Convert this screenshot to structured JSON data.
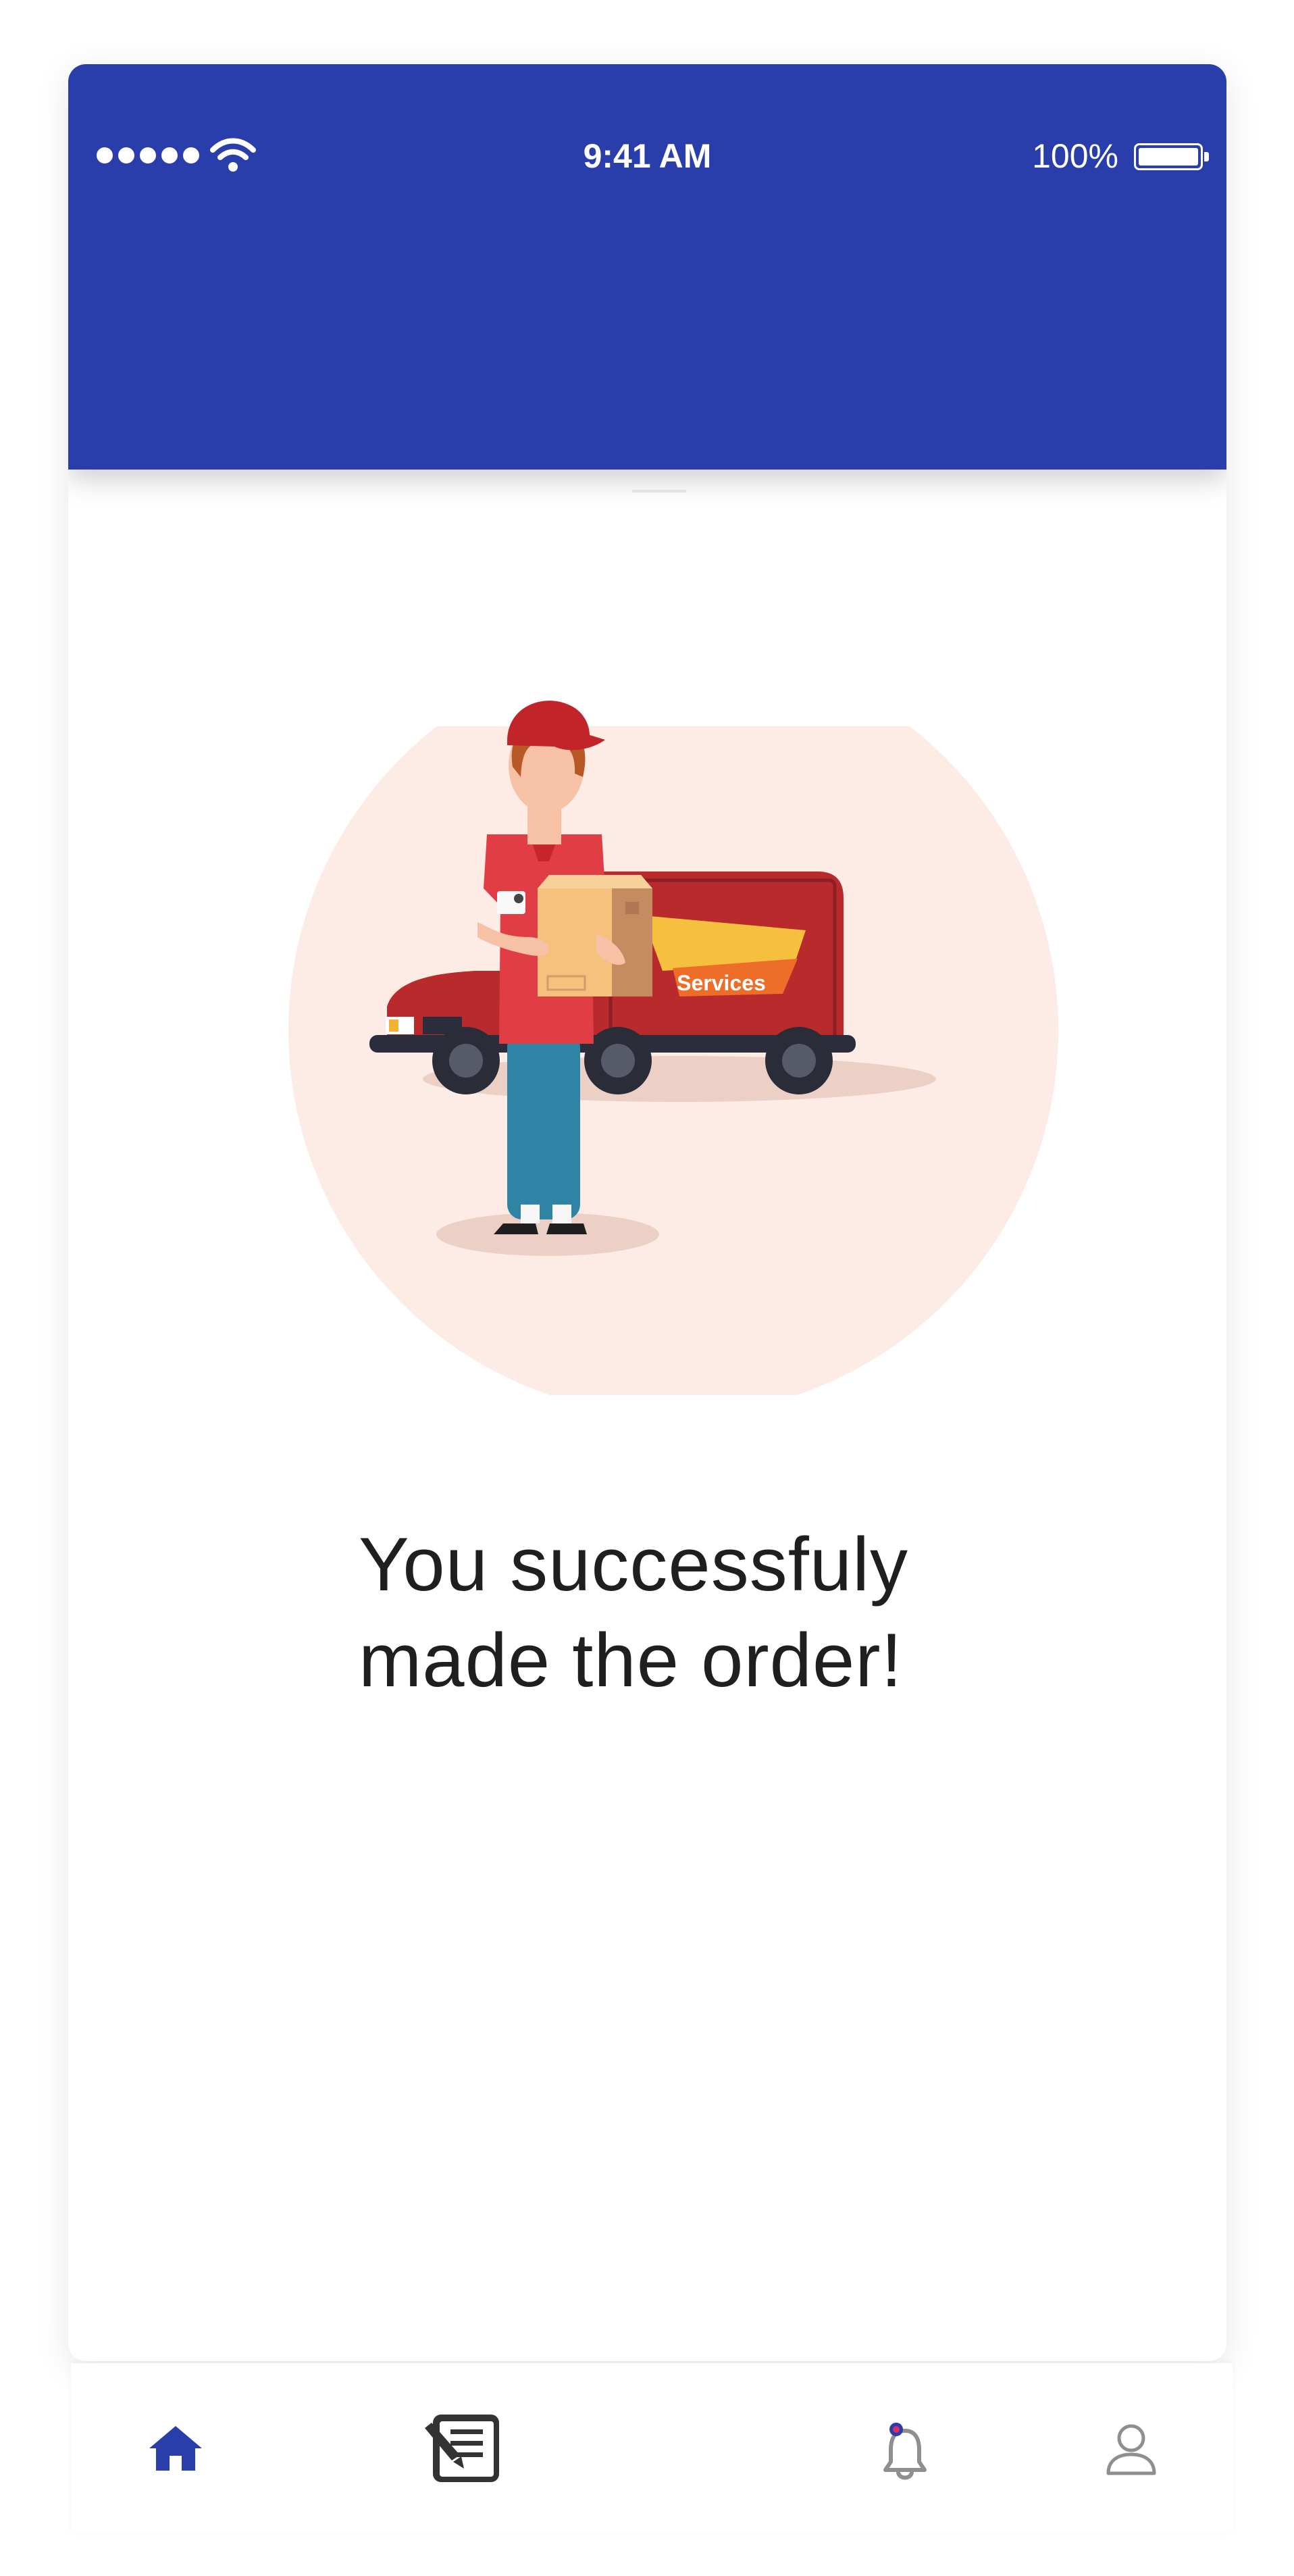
{
  "status_bar": {
    "time": "9:41 AM",
    "battery": "100%",
    "signal_icon": "signal-dots-icon",
    "wifi_icon": "wifi-icon",
    "battery_icon": "battery-icon"
  },
  "colors": {
    "header": "#2a3eab",
    "accent": "#2a3eab",
    "illustration_bg": "#fdebe6",
    "text": "#1f1f1f"
  },
  "illustration": {
    "van_text": "Services",
    "name": "delivery-man-illustration"
  },
  "message": {
    "line1": "You successfuly",
    "line2": "made the order!"
  },
  "bottom_nav": {
    "items": [
      {
        "icon": "home-icon",
        "active": true
      },
      {
        "icon": "orders-icon",
        "active": false
      },
      {
        "icon": "bell-icon",
        "active": false
      },
      {
        "icon": "profile-icon",
        "active": false
      }
    ]
  }
}
